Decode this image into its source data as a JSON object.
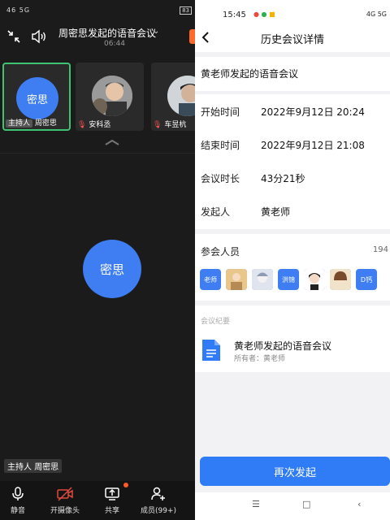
{
  "left": {
    "status": {
      "left": "46 5G",
      "right": "83"
    },
    "header": {
      "title": "周密思发起的语音会议",
      "timer": "06:44"
    },
    "tiles": [
      {
        "avatar_text": "密思",
        "host_tag": "主持人",
        "name": "周密思"
      },
      {
        "name": "安科丞"
      },
      {
        "name": "车昱杭"
      }
    ],
    "main_avatar": "密思",
    "host_overlay": {
      "tag": "主持人",
      "name": "周密思"
    },
    "toolbar": [
      {
        "label": "静音",
        "icon": "mic-icon"
      },
      {
        "label": "开摄像头",
        "icon": "camera-off-icon"
      },
      {
        "label": "共享",
        "icon": "share-screen-icon"
      },
      {
        "label": "成员(99+)",
        "icon": "add-member-icon"
      }
    ],
    "colors": {
      "accent": "#3e7ef2",
      "active_border": "#3fc271",
      "mute": "#ff5252",
      "end": "#ff6a2b"
    }
  },
  "right": {
    "status": {
      "time": "15:45",
      "right": "4G 5G"
    },
    "nav": {
      "title": "历史会议详情"
    },
    "meeting_title": "黄老师发起的语音会议",
    "info": [
      {
        "key": "开始时间",
        "value": "2022年9月12日 20:24"
      },
      {
        "key": "结束时间",
        "value": "2022年9月12日 21:08"
      },
      {
        "key": "会议时长",
        "value": "43分21秒"
      },
      {
        "key": "发起人",
        "value": "黄老师"
      }
    ],
    "participants": {
      "label": "参会人员",
      "count": "194",
      "avatars": [
        {
          "text": "老师",
          "kind": "text"
        },
        {
          "text": "",
          "kind": "photo"
        },
        {
          "text": "",
          "kind": "photo"
        },
        {
          "text": "洪锦",
          "kind": "text"
        },
        {
          "text": "",
          "kind": "photo"
        },
        {
          "text": "",
          "kind": "photo"
        },
        {
          "text": "D钙",
          "kind": "text"
        }
      ]
    },
    "summary": {
      "section_label": "会议纪要",
      "doc_title": "黄老师发起的语音会议",
      "owner": "所有者：黄老师"
    },
    "redo_button": "再次发起",
    "colors": {
      "primary": "#2f7cf6",
      "background": "#f2f2f4",
      "doc_icon": "#2f7cf6"
    }
  }
}
